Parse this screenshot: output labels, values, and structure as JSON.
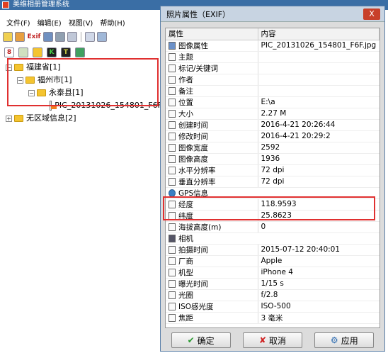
{
  "main": {
    "title": "美维相册管理系统",
    "menu": [
      "文件(F)",
      "编辑(E)",
      "视图(V)",
      "帮助(H)"
    ],
    "tree": [
      {
        "label": "福建省[1]"
      },
      {
        "label": "福州市[1]"
      },
      {
        "label": "永泰县[1]"
      },
      {
        "label": "PIC_20131026_154801_F6F"
      },
      {
        "label": "无区域信息[2]"
      }
    ]
  },
  "dialog": {
    "title": "照片属性（EXIF）",
    "close_label": "X",
    "columns": {
      "name": "属性",
      "value": "内容"
    },
    "rows": [
      {
        "name": "图像属性",
        "value": "PIC_20131026_154801_F6F.jpg",
        "icon": "image-icon"
      },
      {
        "name": "主题",
        "value": "",
        "icon": "doc-icon"
      },
      {
        "name": "标记/关键词",
        "value": "",
        "icon": "doc-icon"
      },
      {
        "name": "作者",
        "value": "",
        "icon": "doc-icon"
      },
      {
        "name": "备注",
        "value": "",
        "icon": "doc-icon"
      },
      {
        "name": "位置",
        "value": "E:\\a",
        "icon": "doc-icon"
      },
      {
        "name": "大小",
        "value": "2.27 M",
        "icon": "doc-icon"
      },
      {
        "name": "创建时间",
        "value": "2016-4-21 20:26:44",
        "icon": "doc-icon"
      },
      {
        "name": "修改时间",
        "value": "2016-4-21 20:29:2",
        "icon": "doc-icon"
      },
      {
        "name": "图像宽度",
        "value": "2592",
        "icon": "doc-icon"
      },
      {
        "name": "图像高度",
        "value": "1936",
        "icon": "doc-icon"
      },
      {
        "name": "水平分辨率",
        "value": "72 dpi",
        "icon": "doc-icon"
      },
      {
        "name": "垂直分辨率",
        "value": "72 dpi",
        "icon": "doc-icon"
      },
      {
        "name": "GPS信息",
        "value": "",
        "icon": "globe-icon",
        "section": true
      },
      {
        "name": "经度",
        "value": "118.9593",
        "icon": "doc-icon"
      },
      {
        "name": "纬度",
        "value": "25.8623",
        "icon": "doc-icon"
      },
      {
        "name": "海拔高度(m)",
        "value": "0",
        "icon": "doc-icon"
      },
      {
        "name": "相机",
        "value": "",
        "icon": "camera-icon",
        "section": true
      },
      {
        "name": "拍摄时间",
        "value": "2015-07-12 20:40:01",
        "icon": "doc-icon"
      },
      {
        "name": "厂商",
        "value": "Apple",
        "icon": "doc-icon"
      },
      {
        "name": "机型",
        "value": "iPhone 4",
        "icon": "doc-icon"
      },
      {
        "name": "曝光时间",
        "value": "1/15 s",
        "icon": "doc-icon"
      },
      {
        "name": "光圈",
        "value": "f/2.8",
        "icon": "doc-icon"
      },
      {
        "name": "ISO感光度",
        "value": "ISO-500",
        "icon": "doc-icon"
      },
      {
        "name": "焦距",
        "value": "3 毫米",
        "icon": "doc-icon"
      }
    ],
    "buttons": {
      "ok": "确定",
      "cancel": "取消",
      "apply": "应用"
    },
    "colors": {
      "highlight": "#e03030",
      "ok": "#2a9a30",
      "cancel": "#d02020"
    }
  }
}
